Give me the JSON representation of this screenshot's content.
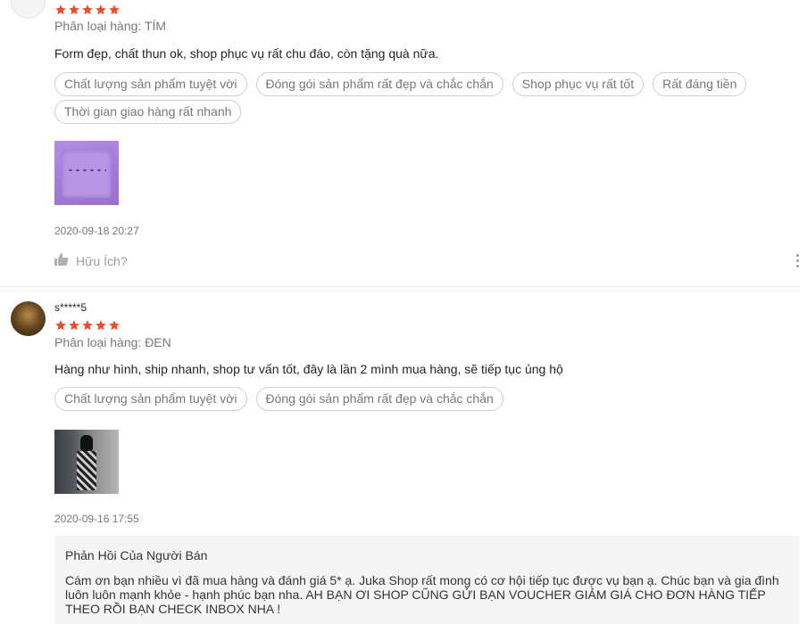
{
  "reviews": [
    {
      "username": "",
      "rating": 5,
      "variation": "Phân loại hàng: TÍM",
      "comment": "Form đẹp, chất thun ok, shop phục vụ rất chu đáo, còn tặng quà nữa.",
      "tags": [
        "Chất lượng sản phẩm tuyệt vời",
        "Đóng gói sản phẩm rất đẹp và chắc chắn",
        "Shop phục vụ rất tốt",
        "Rất đáng tiền",
        "Thời gian giao hàng rất nhanh"
      ],
      "timestamp": "2020-09-18 20:27",
      "helpful_label": "Hữu Ích?"
    },
    {
      "username": "s*****5",
      "rating": 5,
      "variation": "Phân loại hàng: ĐEN",
      "comment": "Hàng như hình, ship nhanh, shop tư vấn tốt, đây là lần 2 mình mua hàng, sẽ tiếp tục ủng hộ",
      "tags": [
        "Chất lượng sản phẩm tuyệt vời",
        "Đóng gói sản phẩm rất đẹp và chắc chắn"
      ],
      "timestamp": "2020-09-16 17:55",
      "seller_reply": {
        "title": "Phản Hồi Của Người Bán",
        "text": "Cám ơn bạn nhiều vì đã mua hàng và đánh giá 5* ạ. Juka Shop rất mong có cơ hội tiếp tục được vụ bạn ạ. Chúc bạn và gia đình luôn luôn mạnh khỏe - hạnh phúc bạn nha. AH BẠN ƠI SHOP CŨNG GỬI BẠN VOUCHER GIẢM GIÁ CHO ĐƠN HÀNG TIẾP THEO RỒI BẠN CHECK INBOX NHA !"
      }
    }
  ],
  "icons": {
    "star": "star-icon",
    "thumbs_up": "thumbs-up-icon",
    "more": "more-vertical-icon"
  },
  "colors": {
    "star": "#ee4d2d",
    "reply_bg": "#f5f5f5"
  }
}
